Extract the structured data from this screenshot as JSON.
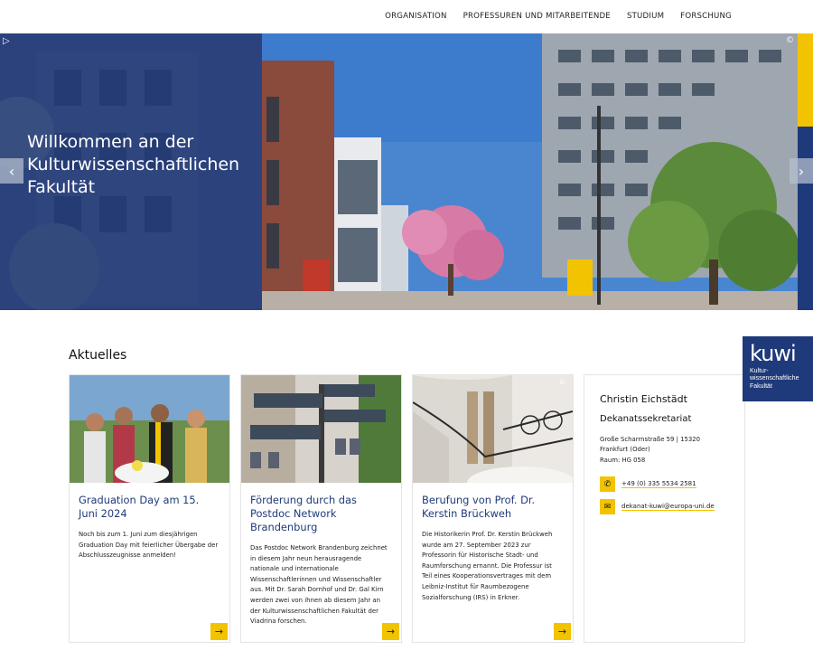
{
  "nav": {
    "items": [
      {
        "label": "ORGANISATION"
      },
      {
        "label": "PROFESSUREN UND MITARBEITENDE"
      },
      {
        "label": "STUDIUM"
      },
      {
        "label": "FORSCHUNG"
      }
    ]
  },
  "hero": {
    "title": "Willkommen an der Kulturwissenschaftlichen Fakultät",
    "copyright": "©",
    "play_icon": "play-icon",
    "prev_icon": "chevron-left-icon",
    "next_icon": "chevron-right-icon"
  },
  "aktuelles": {
    "heading": "Aktuelles",
    "cards": [
      {
        "title": "Graduation Day am 15. Juni 2024",
        "text": "Noch bis zum 1. Juni zum diesjährigen Graduation Day mit feierlicher Übergabe der Abschlusszeugnisse anmelden!"
      },
      {
        "title": "Förderung durch das Postdoc Network Brandenburg",
        "text": "Das Postdoc Network Brandenburg zeichnet in diesem Jahr neun herausragende nationale und internationale Wissenschaftlerinnen und Wissenschaftler aus. Mit Dr. Sarah Dornhof und Dr. Gal Kirn werden zwei von ihnen ab diesem Jahr an der Kulturwissenschaftlichen Fakultät der Viadrina forschen."
      },
      {
        "title": "Berufung von Prof. Dr. Kerstin Brückweh",
        "text": "Die Historikerin Prof. Dr. Kerstin Brückweh wurde am 27. September 2023 zur Professorin für Historische Stadt- und Raumforschung ernannt. Die Professur ist Teil eines Kooperationsvertrages mit dem Leibniz-Institut für Raumbezogene Sozialforschung (IRS) in Erkner.",
        "copyright": "©"
      }
    ]
  },
  "contact": {
    "name": "Christin Eichstädt",
    "role": "Dekanatssekretariat",
    "address": "Große Scharrnstraße 59 | 15320 Frankfurt (Oder)",
    "room": "Raum: HG 058",
    "phone": "+49 (0) 335 5534 2581",
    "email": "dekanat-kuwi@europa-uni.de"
  },
  "kuwi": {
    "logo": "kuwi",
    "subtitle": "Kultur-\nwissenschaftliche\nFakultät"
  },
  "colors": {
    "brand_blue": "#1f3a7a",
    "accent_yellow": "#f2c300"
  }
}
